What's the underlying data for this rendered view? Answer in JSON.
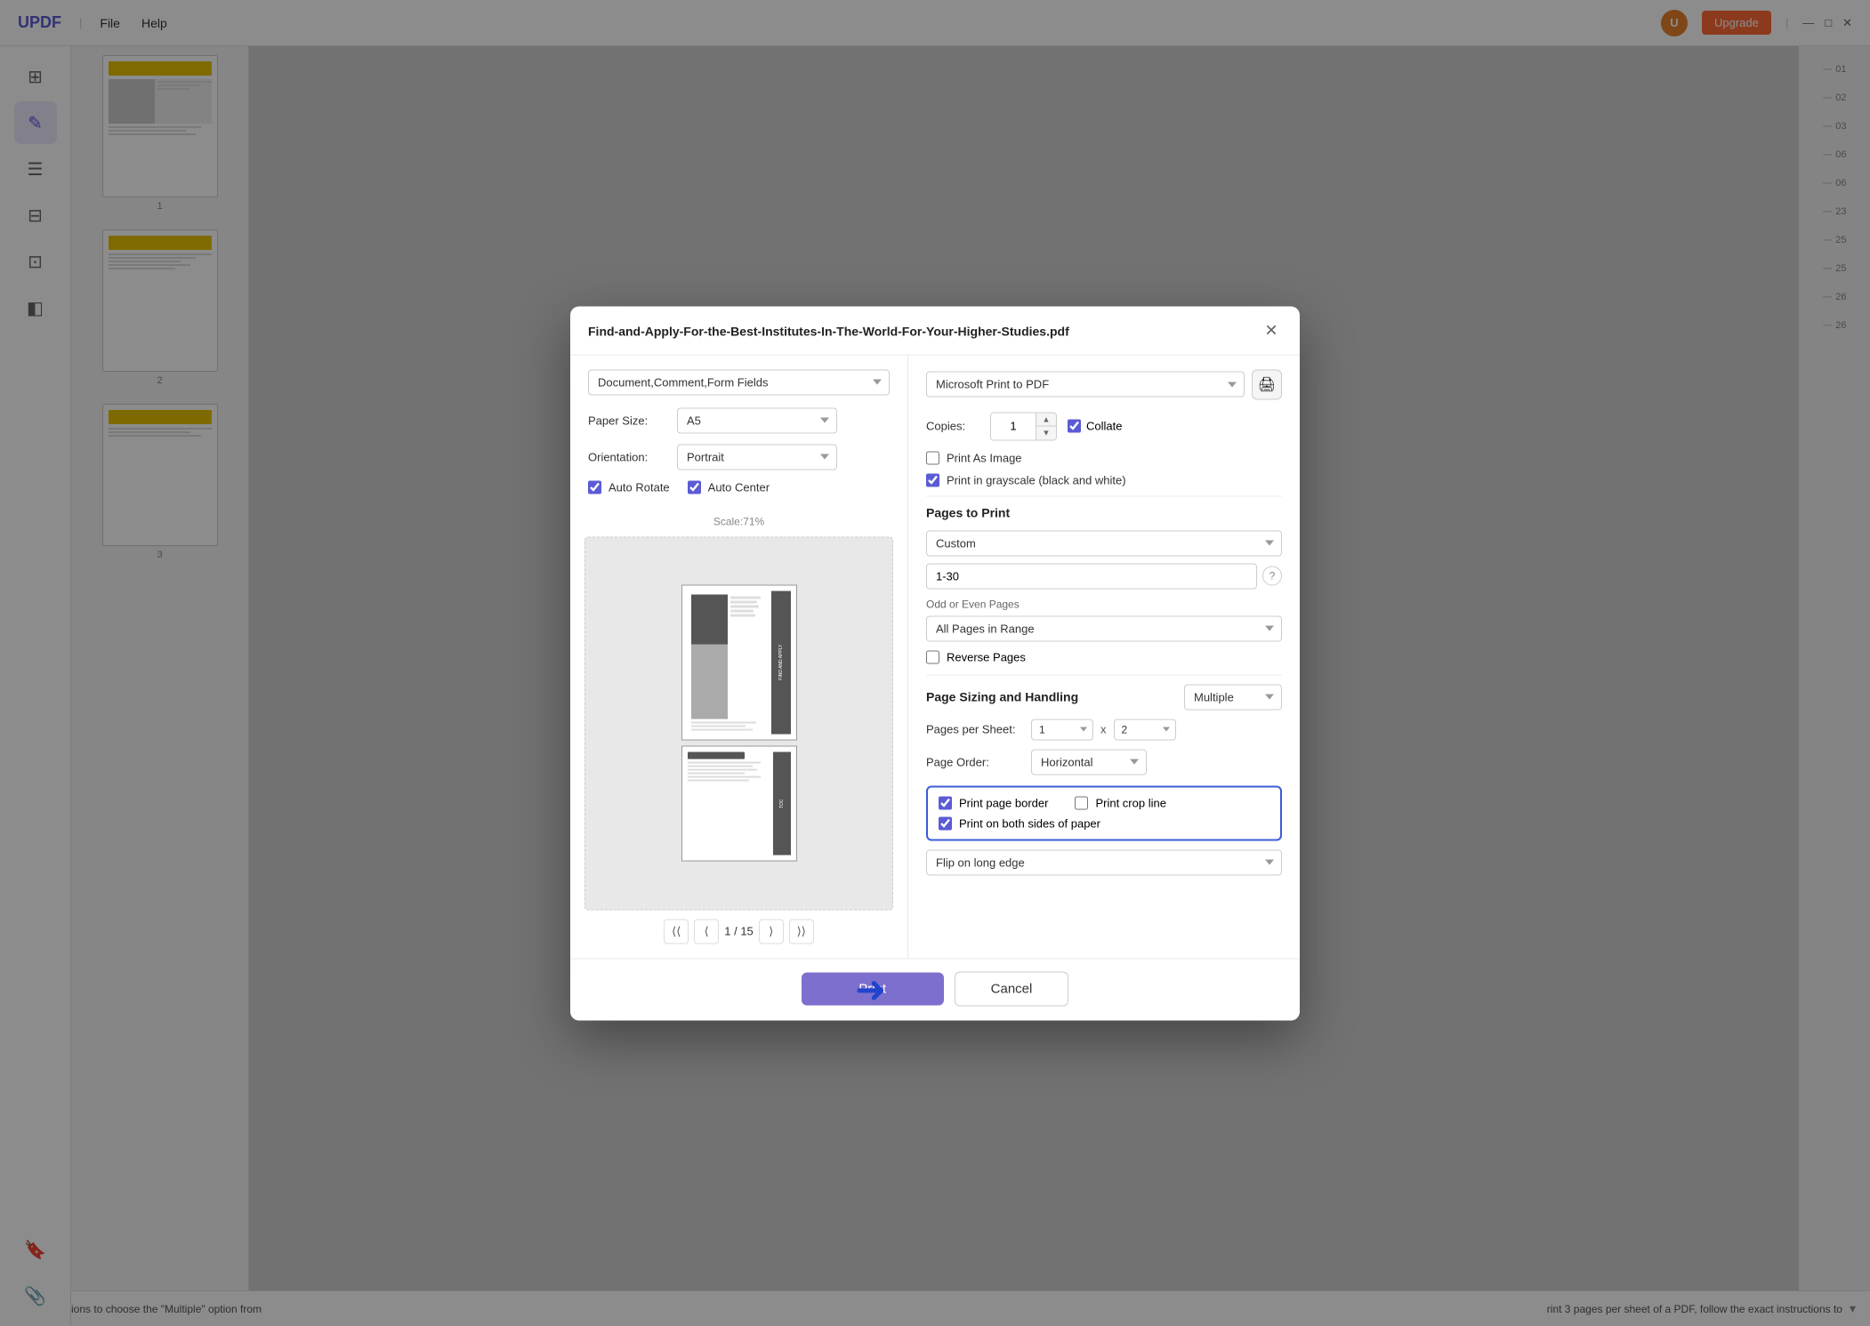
{
  "app": {
    "logo": "UPDF",
    "menu": [
      "File",
      "Help"
    ],
    "upgrade_label": "Upgrade",
    "user_initial": "U"
  },
  "window_controls": {
    "minimize": "—",
    "maximize": "□",
    "close": "✕"
  },
  "dialog": {
    "title": "Find-and-Apply-For-the-Best-Institutes-In-The-World-For-Your-Higher-Studies.pdf",
    "close_icon": "✕",
    "left": {
      "content_dropdown": "Document,Comment,Form Fields",
      "paper_size_label": "Paper Size:",
      "paper_size_value": "A5",
      "orientation_label": "Orientation:",
      "orientation_value": "Portrait",
      "auto_rotate_label": "Auto Rotate",
      "auto_center_label": "Auto Center",
      "scale_label": "Scale:71%",
      "pagination": {
        "page_current": "1",
        "page_separator": "/",
        "page_total": "15"
      }
    },
    "right": {
      "printer_value": "Microsoft Print to PDF",
      "copies_label": "Copies:",
      "copies_value": "1",
      "collate_label": "Collate",
      "print_as_image_label": "Print As Image",
      "print_grayscale_label": "Print in grayscale (black and white)",
      "pages_to_print_title": "Pages to Print",
      "pages_dropdown": "Custom",
      "pages_range": "1-30",
      "odd_even_label": "Odd or Even Pages",
      "all_pages_label": "All Pages in Range",
      "reverse_pages_label": "Reverse Pages",
      "page_sizing_title": "Page Sizing and Handling",
      "page_sizing_mode": "Multiple",
      "pages_per_sheet_label": "Pages per Sheet:",
      "pps_x_value": "1",
      "pps_y_value": "2",
      "page_order_label": "Page Order:",
      "page_order_value": "Horizontal",
      "print_page_border_label": "Print page border",
      "print_crop_line_label": "Print crop line",
      "print_both_sides_label": "Print on both sides of paper",
      "flip_on_long_edge_label": "Flip on long edge",
      "print_button": "Print",
      "cancel_button": "Cancel"
    }
  },
  "sidebar": {
    "icons": [
      {
        "name": "home-icon",
        "glyph": "⊞",
        "active": false
      },
      {
        "name": "edit-icon",
        "glyph": "✎",
        "active": true
      },
      {
        "name": "list-icon",
        "glyph": "☰",
        "active": false
      },
      {
        "name": "page-icon",
        "glyph": "⊟",
        "active": false
      },
      {
        "name": "form-icon",
        "glyph": "⊡",
        "active": false
      },
      {
        "name": "layers-icon",
        "glyph": "◧",
        "active": false
      },
      {
        "name": "bookmark-icon",
        "glyph": "🔖",
        "active": false
      },
      {
        "name": "pin-icon",
        "glyph": "📎",
        "active": false
      }
    ]
  },
  "right_panel": {
    "items": [
      {
        "dots": ".....",
        "num": "01"
      },
      {
        "dots": ".....",
        "num": "02"
      },
      {
        "dots": ".....",
        "num": "03"
      },
      {
        "dots": ".....",
        "num": "06"
      },
      {
        "dots": ".....",
        "num": "06"
      },
      {
        "dots": ".....",
        "num": "23"
      },
      {
        "dots": ".....",
        "num": "25"
      },
      {
        "dots": ".....",
        "num": "25"
      },
      {
        "dots": ".....",
        "num": "26"
      },
      {
        "dots": ".....",
        "num": "26"
      }
    ]
  },
  "bottom_bar": {
    "text": "xact instructions to choose the \"Multiple\" option from",
    "text2": "rint 3 pages per sheet of a PDF, follow the exact instructions to"
  }
}
